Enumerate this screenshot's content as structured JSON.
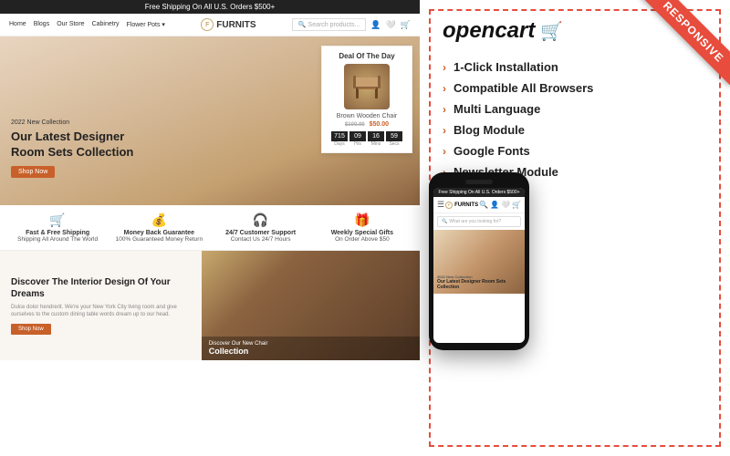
{
  "topbar": {
    "text": "Free Shipping On All U.S. Orders $500+"
  },
  "nav": {
    "links": [
      "Home",
      "Blogs",
      "Our Store",
      "Cabinetry",
      "Flower Pots"
    ],
    "logo_letter": "F",
    "logo_name": "FURNITS",
    "search_placeholder": "Search products..."
  },
  "hero": {
    "badge": "2022 New Collection",
    "title": "Our Latest Designer Room Sets Collection",
    "cta": "Shop Now"
  },
  "deal": {
    "title": "Deal Of The Day",
    "product_name": "Brown Wooden Chair",
    "price": "$50.00",
    "old_price": "$100.00",
    "timer": {
      "days": "715",
      "hours": "09",
      "minutes": "16",
      "seconds": "59",
      "labels": [
        "Days",
        "Hrs",
        "Mins",
        "Secs"
      ]
    }
  },
  "features": [
    {
      "icon": "🛒",
      "title": "Fast & Free Shipping",
      "desc": "Shipping All Around The World"
    },
    {
      "icon": "💰",
      "title": "Money Back Guarantee",
      "desc": "100% Guaranteed Money Return"
    },
    {
      "icon": "🎧",
      "title": "24/7 Customer Support",
      "desc": "Contact Us 24/7 Hours"
    },
    {
      "icon": "🎁",
      "title": "Weekly Special Gifts",
      "desc": "On Order Above $50"
    }
  ],
  "interior": {
    "title": "Discover The Interior Design Of Your Dreams",
    "text": "Dulce dolor hendrerit. We're your New York City living room and give ourselves to the custom dining table words dream up to our head.",
    "cta": "Shop Now"
  },
  "sofa": {
    "subtitle": "Discover Our New Chair",
    "title": "Collection"
  },
  "opencart": {
    "logo_text": "opencart",
    "cart_symbol": "⛟"
  },
  "responsive_badge": "RESPONSIVE",
  "feature_list": [
    {
      "label": "1-Click Installation"
    },
    {
      "label": "Compatible All Browsers"
    },
    {
      "label": "Multi Language"
    },
    {
      "label": "Blog Module"
    },
    {
      "label": "Google Fonts"
    },
    {
      "label": "Newsletter Module"
    }
  ],
  "phone": {
    "topbar": "Free Shipping On All U.S. Orders $500+",
    "logo_letter": "F",
    "logo_name": "FURNITS",
    "search_placeholder": "What are you looking for?",
    "hero_badge": "2022 New Collection",
    "hero_title": "Our Latest Designer Room Sets Collection"
  }
}
